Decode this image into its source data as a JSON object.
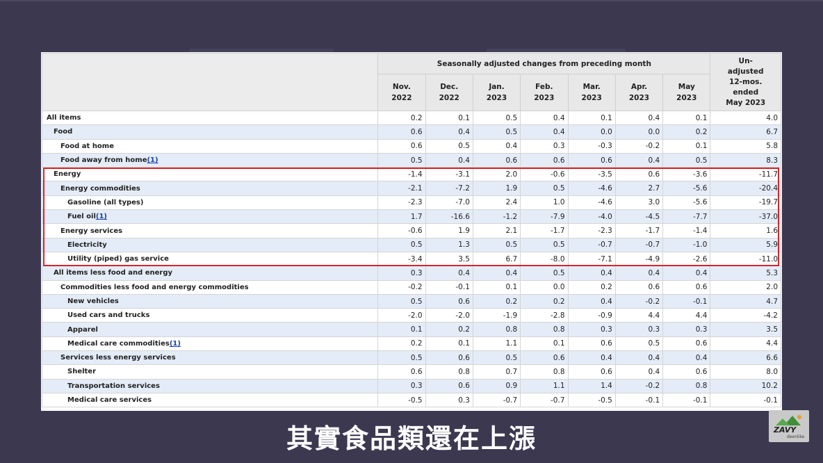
{
  "table": {
    "group_header": "Seasonally adjusted changes from preceding month",
    "unadjusted_header": [
      "Un-",
      "adjusted",
      "12-mos.",
      "ended",
      "May 2023"
    ],
    "months": [
      [
        "Nov.",
        "2022"
      ],
      [
        "Dec.",
        "2022"
      ],
      [
        "Jan.",
        "2023"
      ],
      [
        "Feb.",
        "2023"
      ],
      [
        "Mar.",
        "2023"
      ],
      [
        "Apr.",
        "2023"
      ],
      [
        "May",
        "2023"
      ]
    ],
    "rows": [
      {
        "label": "All items",
        "fn": "",
        "values": [
          "0.2",
          "0.1",
          "0.5",
          "0.4",
          "0.1",
          "0.4",
          "0.1",
          "4.0"
        ]
      },
      {
        "label": "Food",
        "fn": "",
        "values": [
          "0.6",
          "0.4",
          "0.5",
          "0.4",
          "0.0",
          "0.0",
          "0.2",
          "6.7"
        ]
      },
      {
        "label": "Food at home",
        "fn": "",
        "values": [
          "0.6",
          "0.5",
          "0.4",
          "0.3",
          "-0.3",
          "-0.2",
          "0.1",
          "5.8"
        ]
      },
      {
        "label": "Food away from home",
        "fn": "(1)",
        "values": [
          "0.5",
          "0.4",
          "0.6",
          "0.6",
          "0.6",
          "0.4",
          "0.5",
          "8.3"
        ]
      },
      {
        "label": "Energy",
        "fn": "",
        "values": [
          "-1.4",
          "-3.1",
          "2.0",
          "-0.6",
          "-3.5",
          "0.6",
          "-3.6",
          "-11.7"
        ]
      },
      {
        "label": "Energy commodities",
        "fn": "",
        "values": [
          "-2.1",
          "-7.2",
          "1.9",
          "0.5",
          "-4.6",
          "2.7",
          "-5.6",
          "-20.4"
        ]
      },
      {
        "label": "Gasoline (all types)",
        "fn": "",
        "values": [
          "-2.3",
          "-7.0",
          "2.4",
          "1.0",
          "-4.6",
          "3.0",
          "-5.6",
          "-19.7"
        ]
      },
      {
        "label": "Fuel oil",
        "fn": "(1)",
        "values": [
          "1.7",
          "-16.6",
          "-1.2",
          "-7.9",
          "-4.0",
          "-4.5",
          "-7.7",
          "-37.0"
        ]
      },
      {
        "label": "Energy services",
        "fn": "",
        "values": [
          "-0.6",
          "1.9",
          "2.1",
          "-1.7",
          "-2.3",
          "-1.7",
          "-1.4",
          "1.6"
        ]
      },
      {
        "label": "Electricity",
        "fn": "",
        "values": [
          "0.5",
          "1.3",
          "0.5",
          "0.5",
          "-0.7",
          "-0.7",
          "-1.0",
          "5.9"
        ]
      },
      {
        "label": "Utility (piped) gas service",
        "fn": "",
        "values": [
          "-3.4",
          "3.5",
          "6.7",
          "-8.0",
          "-7.1",
          "-4.9",
          "-2.6",
          "-11.0"
        ]
      },
      {
        "label": "All items less food and energy",
        "fn": "",
        "values": [
          "0.3",
          "0.4",
          "0.4",
          "0.5",
          "0.4",
          "0.4",
          "0.4",
          "5.3"
        ]
      },
      {
        "label": "Commodities less food and energy commodities",
        "fn": "",
        "values": [
          "-0.2",
          "-0.1",
          "0.1",
          "0.0",
          "0.2",
          "0.6",
          "0.6",
          "2.0"
        ]
      },
      {
        "label": "New vehicles",
        "fn": "",
        "values": [
          "0.5",
          "0.6",
          "0.2",
          "0.2",
          "0.4",
          "-0.2",
          "-0.1",
          "4.7"
        ]
      },
      {
        "label": "Used cars and trucks",
        "fn": "",
        "values": [
          "-2.0",
          "-2.0",
          "-1.9",
          "-2.8",
          "-0.9",
          "4.4",
          "4.4",
          "-4.2"
        ]
      },
      {
        "label": "Apparel",
        "fn": "",
        "values": [
          "0.1",
          "0.2",
          "0.8",
          "0.8",
          "0.3",
          "0.3",
          "0.3",
          "3.5"
        ]
      },
      {
        "label": "Medical care commodities",
        "fn": "(1)",
        "values": [
          "0.2",
          "0.1",
          "1.1",
          "0.1",
          "0.6",
          "0.5",
          "0.6",
          "4.4"
        ]
      },
      {
        "label": "Services less energy services",
        "fn": "",
        "values": [
          "0.5",
          "0.6",
          "0.5",
          "0.6",
          "0.4",
          "0.4",
          "0.4",
          "6.6"
        ]
      },
      {
        "label": "Shelter",
        "fn": "",
        "values": [
          "0.6",
          "0.8",
          "0.7",
          "0.8",
          "0.6",
          "0.4",
          "0.6",
          "8.0"
        ]
      },
      {
        "label": "Transportation services",
        "fn": "",
        "values": [
          "0.3",
          "0.6",
          "0.9",
          "1.1",
          "1.4",
          "-0.2",
          "0.8",
          "10.2"
        ]
      },
      {
        "label": "Medical care services",
        "fn": "",
        "values": [
          "-0.5",
          "0.3",
          "-0.7",
          "-0.7",
          "-0.5",
          "-0.1",
          "-0.1",
          "-0.1"
        ]
      }
    ]
  },
  "subtitle": "其實食品類還在上漲",
  "logo": {
    "text": "ZAVY",
    "sub": "deenlike"
  },
  "colors": {
    "highlight": "#d9232a",
    "alt_row": "#e4ecf8",
    "background": "#3b3850"
  }
}
